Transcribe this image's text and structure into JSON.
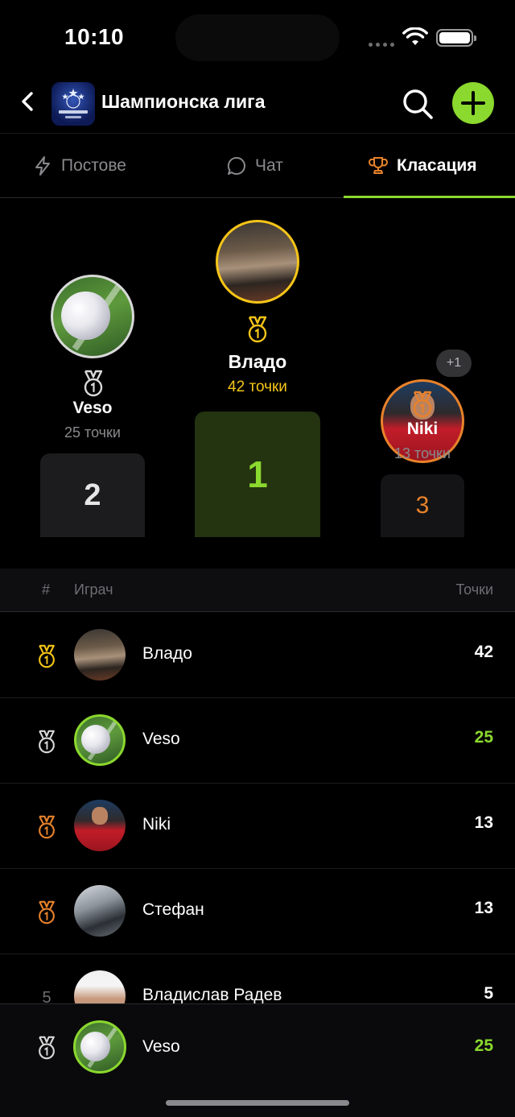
{
  "status_bar": {
    "time": "10:10"
  },
  "header": {
    "title": "Шампионска лига"
  },
  "tabs": [
    {
      "label": "Постове",
      "icon": "bolt-icon",
      "active": false
    },
    {
      "label": "Чат",
      "icon": "chat-bubble-icon",
      "active": false
    },
    {
      "label": "Класация",
      "icon": "trophy-icon",
      "active": true
    }
  ],
  "podium": {
    "first": {
      "name": "Владо",
      "points": "42 точки",
      "place": "1",
      "medal_color": "#f5c518"
    },
    "second": {
      "name": "Veso",
      "points": "25 точки",
      "place": "2",
      "medal_color": "#d9d9d9"
    },
    "third": {
      "name": "Niki",
      "points": "13 точки",
      "place": "3",
      "medal_color": "#e8822a",
      "extra_badge": "+1"
    }
  },
  "table": {
    "headers": {
      "rank": "#",
      "player": "Играч",
      "points": "Точки"
    },
    "rows": [
      {
        "rank": "",
        "medal": "gold",
        "name": "Владо",
        "points": "42"
      },
      {
        "rank": "",
        "medal": "silver",
        "name": "Veso",
        "points": "25",
        "highlight": true
      },
      {
        "rank": "",
        "medal": "bronze",
        "name": "Niki",
        "points": "13"
      },
      {
        "rank": "",
        "medal": "bronze",
        "name": "Стефан",
        "points": "13"
      },
      {
        "rank": "5",
        "medal": "",
        "name": "Владислав Радев",
        "points": "5"
      }
    ]
  },
  "current_user": {
    "name": "Veso",
    "points": "25",
    "medal": "silver"
  },
  "colors": {
    "accent": "#8bd82e",
    "gold": "#f5c518",
    "silver": "#d9d9d9",
    "bronze": "#e8822a",
    "background": "#000000"
  }
}
